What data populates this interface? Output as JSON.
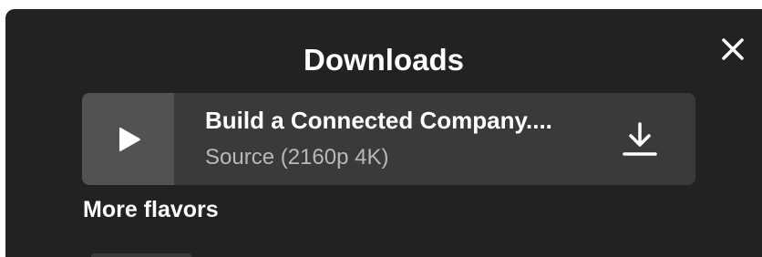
{
  "dialog": {
    "title": "Downloads",
    "close_icon": "close-icon"
  },
  "download_item": {
    "title": "Build a Connected Company....",
    "subtitle": "Source (2160p 4K)",
    "play_icon": "play-icon",
    "download_icon": "download-icon"
  },
  "more_flavors_label": "More flavors",
  "colors": {
    "dialog_bg": "#222222",
    "row_bg": "#3a3a3a",
    "thumb_bg": "#525252",
    "text_primary": "#ffffff",
    "text_secondary": "#b8b8b8"
  }
}
